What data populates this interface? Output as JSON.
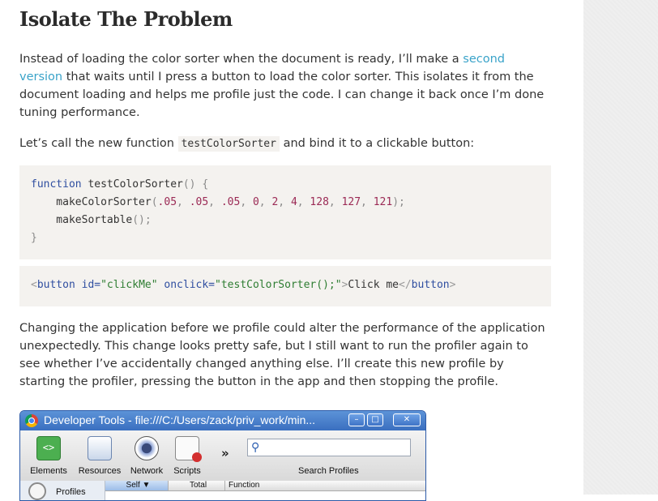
{
  "article": {
    "heading": "Isolate The Problem",
    "p1_before_link": "Instead of loading the color sorter when the document is ready, I’ll make a ",
    "p1_link": "second version",
    "p1_after_link": " that waits until I press a button to load the color sorter. This isolates it from the document loading and helps me profile just the code. I can change it back once I’m done tuning performance.",
    "p2_before_code": "Let’s call the new function ",
    "p2_code": "testColorSorter",
    "p2_after_code": " and bind it to a clickable button:",
    "code1": {
      "l1_kw": "function",
      "l1_name": " testColorSorter",
      "l1_tail": "() {",
      "l2_name": "    makeColorSorter",
      "l2_open": "(",
      "args": [
        ".05",
        ".05",
        ".05",
        "0",
        "2",
        "4",
        "128",
        "127",
        "121"
      ],
      "l2_close": ");",
      "l3_name": "    makeSortable",
      "l3_tail": "();",
      "l4": "}"
    },
    "code2": {
      "lt": "<",
      "tag": "button",
      "attr1": " id=",
      "val1": "\"clickMe\"",
      "attr2": " onclick=",
      "val2": "\"testColorSorter();\"",
      "gt": ">",
      "text": "Click me",
      "close_lt": "</",
      "close_tag": "button",
      "close_gt": ">"
    },
    "p3": "Changing the application before we profile could alter the performance of the application unexpectedly. This change looks pretty safe, but I still want to run the profiler again to see whether I’ve accidentally changed anything else. I’ll create this new profile by starting the profiler, pressing the button in the app and then stopping the profile."
  },
  "devtools": {
    "title": "Developer Tools - file:///C:/Users/zack/priv_work/min...",
    "win_min": "–",
    "win_max": "□",
    "win_close": "✕",
    "tools": [
      {
        "label": "Elements",
        "icon": "elements-icon"
      },
      {
        "label": "Resources",
        "icon": "resources-icon"
      },
      {
        "label": "Network",
        "icon": "network-icon"
      },
      {
        "label": "Scripts",
        "icon": "scripts-icon"
      }
    ],
    "overflow": "»",
    "search_label": "Search Profiles",
    "search_value": "",
    "profiles_label": "Profiles",
    "columns": [
      "Self",
      "Total",
      "Function"
    ],
    "sort_indicator": "▼"
  },
  "colors": {
    "link": "#3aa3c9",
    "code_bg": "#f4f2ef",
    "titlebar": "#3a6fc0"
  }
}
